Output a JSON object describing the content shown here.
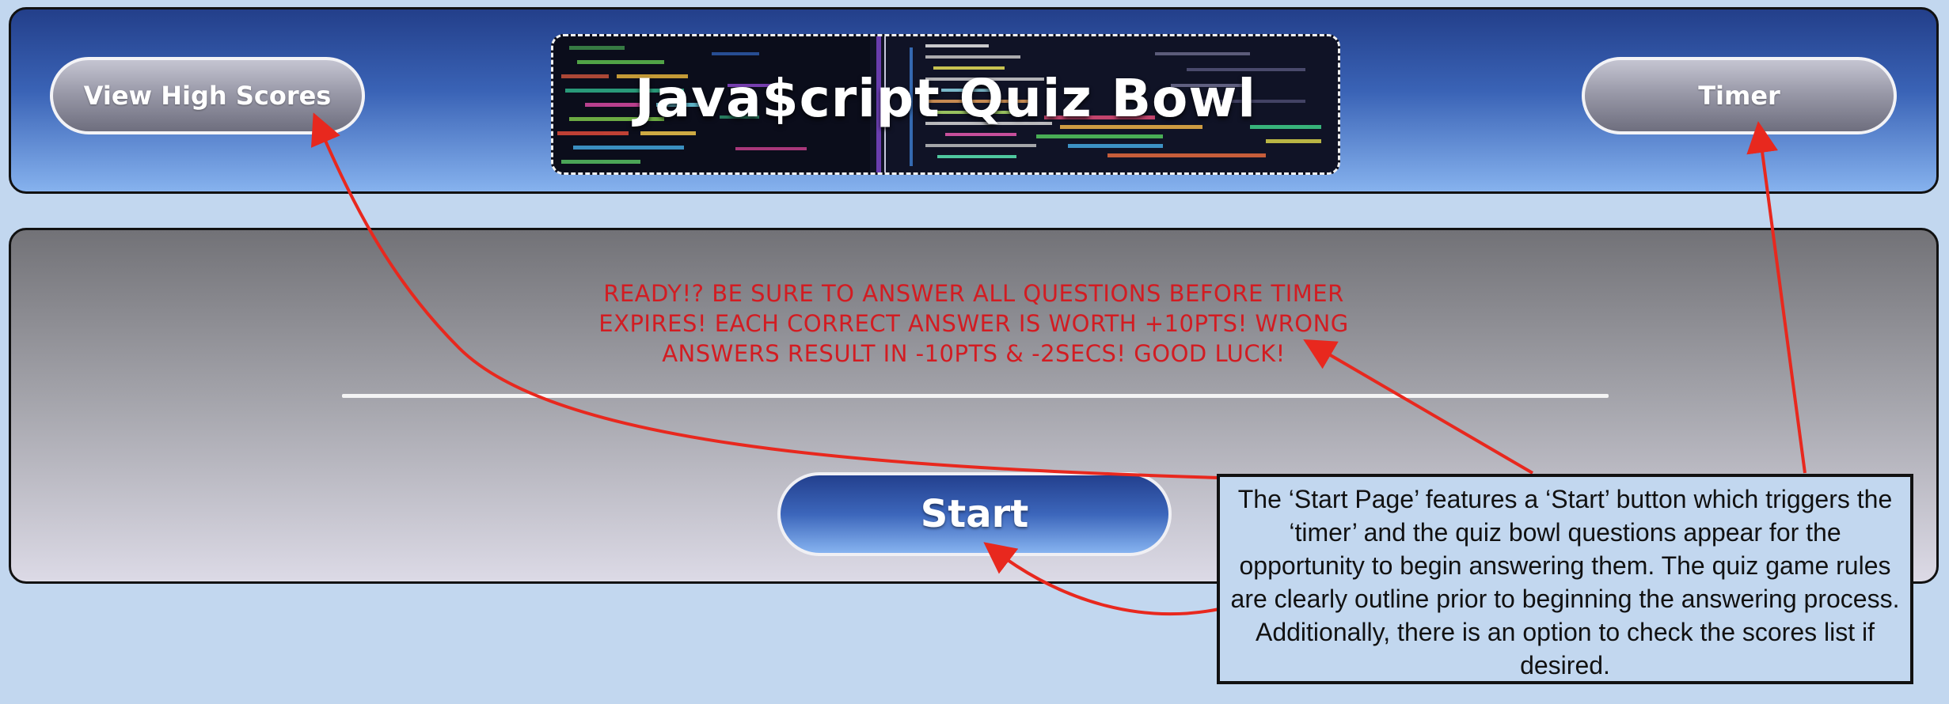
{
  "header": {
    "high_scores_label": "View High Scores",
    "timer_label": "Timer",
    "title": "Java$cript Quiz Bowl"
  },
  "main": {
    "rules": "READY!? BE SURE TO ANSWER ALL QUESTIONS BEFORE TIMER EXPIRES! EACH CORRECT ANSWER IS WORTH +10PTS! WRONG ANSWERS RESULT IN -10PTS & -2SECS! GOOD LUCK!",
    "start_label": "Start"
  },
  "annotation": {
    "text": "The ‘Start Page’ features a ‘Start’ button which triggers the ‘timer’ and the quiz bowl questions appear for the opportunity to begin answering them. The quiz game rules are clearly outline prior to beginning the answering process. Additionally, there is an option to check the scores list if desired."
  },
  "colors": {
    "page_background": "#c2d7ef",
    "header_gradient_top": "#233f8a",
    "header_gradient_bottom": "#86b2ee",
    "rules_text": "#d21c22",
    "arrow": "#e8281e"
  },
  "icons": [
    "code-background-image",
    "annotation-arrow"
  ]
}
